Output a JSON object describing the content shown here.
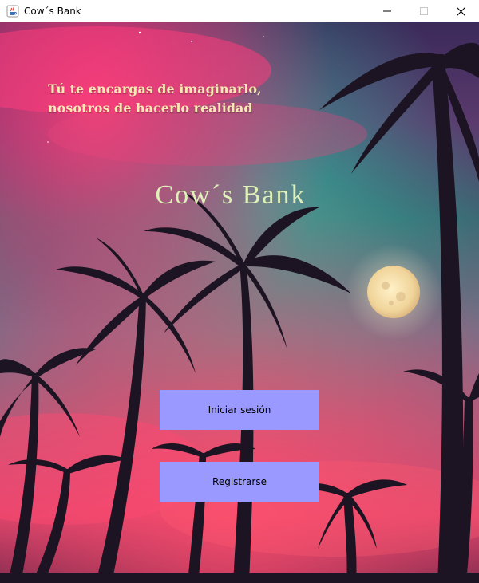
{
  "window": {
    "title": "Cow´s Bank",
    "icon": "java-cup-icon",
    "controls": [
      "minimize-icon",
      "maximize-icon",
      "close-icon"
    ]
  },
  "main": {
    "tagline_line1": "Tú te encargas de imaginarlo,",
    "tagline_line2": "nosotros de hacerlo realidad",
    "bank_name": "Cow´s Bank",
    "login_label": "Iniciar sesión",
    "register_label": "Registrarse"
  },
  "colors": {
    "button_bg": "#9999ff",
    "tagline": "#f6e9b4",
    "bank_name": "#dff0b8"
  }
}
